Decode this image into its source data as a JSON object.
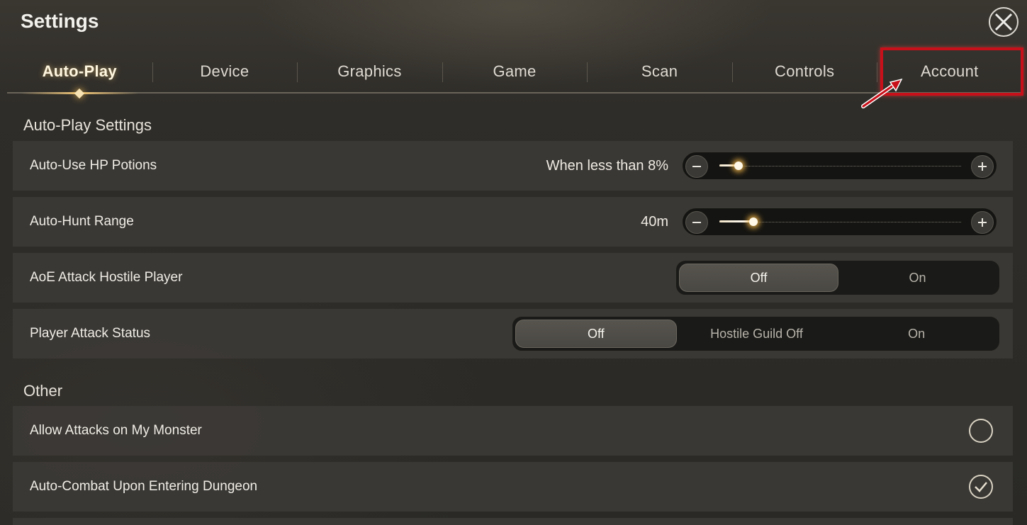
{
  "window": {
    "title": "Settings"
  },
  "tabs": [
    {
      "label": "Auto-Play",
      "active": true
    },
    {
      "label": "Device",
      "active": false
    },
    {
      "label": "Graphics",
      "active": false
    },
    {
      "label": "Game",
      "active": false
    },
    {
      "label": "Scan",
      "active": false
    },
    {
      "label": "Controls",
      "active": false
    },
    {
      "label": "Account",
      "active": false
    }
  ],
  "sections": {
    "autoplay": {
      "title": "Auto-Play Settings"
    },
    "other": {
      "title": "Other"
    }
  },
  "settings": {
    "hp_potions": {
      "label": "Auto-Use HP Potions",
      "value_text": "When less than 8%",
      "level": 0.08
    },
    "hunt_range": {
      "label": "Auto-Hunt Range",
      "value_text": "40m",
      "level": 0.14
    },
    "aoe_attack": {
      "label": "AoE Attack Hostile Player",
      "options": [
        "Off",
        "On"
      ],
      "selected": "Off"
    },
    "player_attack_status": {
      "label": "Player Attack Status",
      "options": [
        "Off",
        "Hostile Guild Off",
        "On"
      ],
      "selected": "Off"
    },
    "allow_attacks_monster": {
      "label": "Allow Attacks on My Monster",
      "checked": false
    },
    "auto_combat_dungeon": {
      "label": "Auto-Combat Upon Entering Dungeon",
      "checked": true
    }
  },
  "colors": {
    "accent_glow": "#f0b94f",
    "highlight_red": "#c8101a"
  },
  "icons": {
    "close": "close-icon",
    "minus": "minus-icon",
    "plus": "plus-icon",
    "check": "check-icon"
  }
}
